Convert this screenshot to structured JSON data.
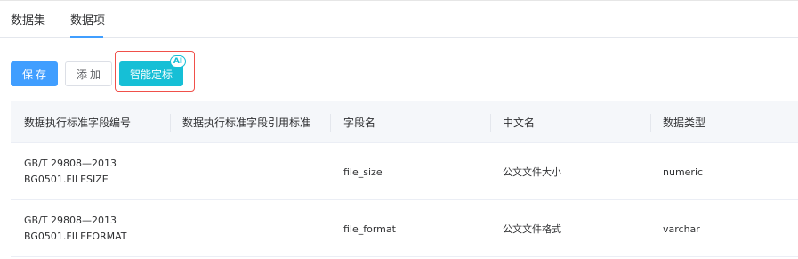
{
  "tabs": [
    {
      "label": "数据集"
    },
    {
      "label": "数据项"
    }
  ],
  "toolbar": {
    "save_label": "保存",
    "add_label": "添加",
    "ai_label": "智能定标",
    "ai_badge": "AI"
  },
  "colors": {
    "primary": "#409eff",
    "ai_button": "#16bfd6",
    "highlight_border": "#f0504a"
  },
  "table": {
    "headers": [
      "数据执行标准字段编号",
      "数据执行标准字段引用标准",
      "字段名",
      "中文名",
      "数据类型"
    ],
    "rows": [
      {
        "code_line1": "GB/T 29808—2013",
        "code_line2": "BG0501.FILESIZE",
        "ref": "",
        "field": "file_size",
        "cn_name": "公文文件大小",
        "type": "numeric"
      },
      {
        "code_line1": "GB/T 29808—2013",
        "code_line2": "BG0501.FILEFORMAT",
        "ref": "",
        "field": "file_format",
        "cn_name": "公文文件格式",
        "type": "varchar"
      }
    ]
  }
}
